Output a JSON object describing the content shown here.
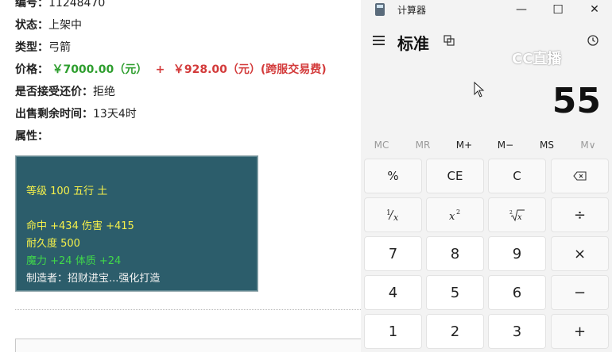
{
  "listing": {
    "id_label": "编号：",
    "id_value": "11248470",
    "status_label": "状态：",
    "status_value": "上架中",
    "type_label": "类型：",
    "type_value": "弓箭",
    "price_label": "价格：",
    "price_main": "￥7000.00（元）",
    "price_plus": "+",
    "price_fee": "￥928.00（元）(跨服交易费)",
    "bargain_label": "是否接受还价：",
    "bargain_value": "拒绝",
    "time_label": "出售剩余时间：",
    "time_value": "13天4时",
    "attr_label": "属性："
  },
  "item_panel": {
    "line_level": "等级 100 五行 土",
    "line_hit": "命中 +434 伤害 +415",
    "line_durability": "耐久度 500",
    "line_magic": "魔力 +24 体质 +24",
    "line_maker": "制造者：招财进宝...强化打造",
    "colors": {
      "panel_bg": "#2c5d6b",
      "yellow": "#f5f04a",
      "green": "#41d84a",
      "white": "#f2f2f2"
    }
  },
  "calculator": {
    "app_title": "计算器",
    "mode_title": "标准",
    "display_value": "55",
    "watermark": "CC直播",
    "window_buttons": {
      "minimize": "—",
      "maximize": "☐",
      "close": "✕"
    },
    "memory": [
      "MC",
      "MR",
      "M+",
      "M−",
      "MS",
      "M∨"
    ],
    "keys": {
      "percent": "%",
      "ce": "CE",
      "c": "C",
      "divide": "÷",
      "multiply": "×",
      "minus": "−",
      "plus": "+",
      "n7": "7",
      "n8": "8",
      "n9": "9",
      "n4": "4",
      "n5": "5",
      "n6": "6",
      "n1": "1",
      "n2": "2",
      "n3": "3"
    },
    "icons": [
      "backspace-icon",
      "reciprocal-icon",
      "square-icon",
      "square-root-icon",
      "menu-icon",
      "keep-on-top-icon",
      "history-icon"
    ]
  },
  "colors": {
    "price_green": "#2e9e2e",
    "price_red": "#d33b3b",
    "calc_bg": "#f3f3f3"
  }
}
